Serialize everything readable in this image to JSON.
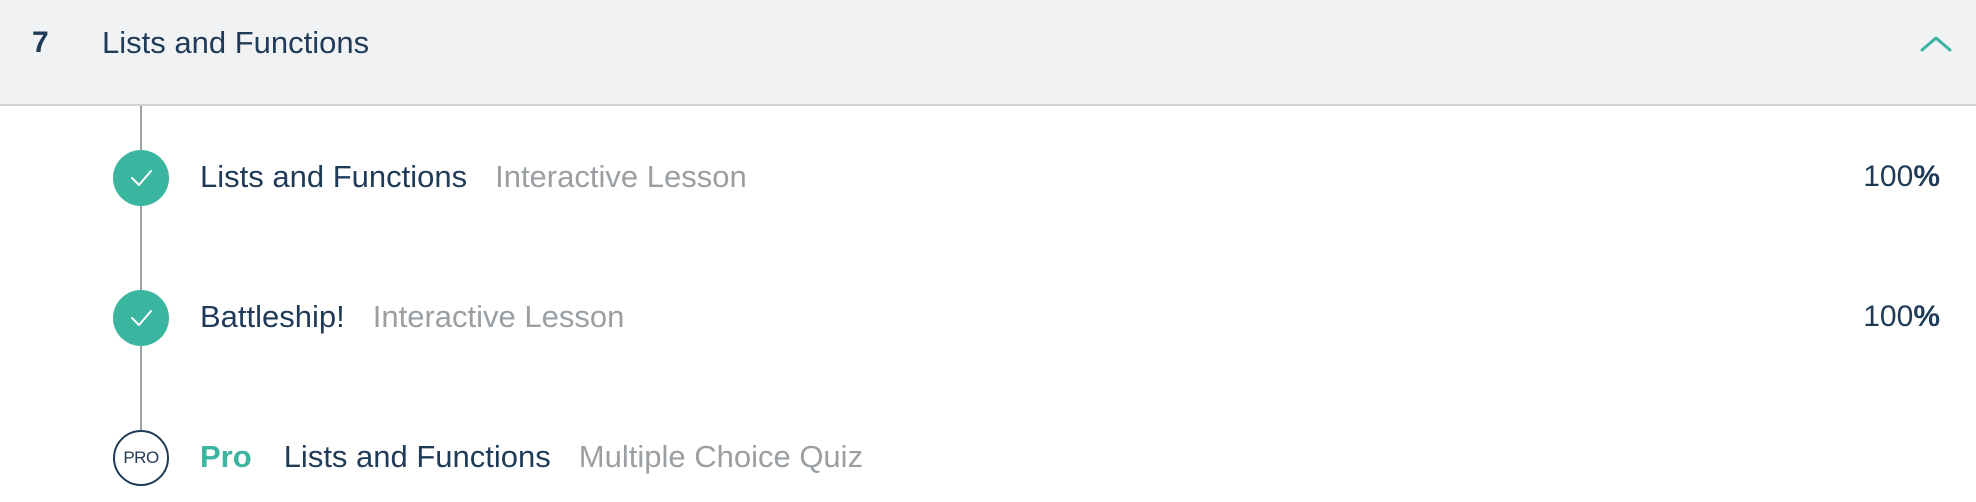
{
  "module": {
    "number": "7",
    "title": "Lists and Functions",
    "toggle_icon": "chevron-up-icon",
    "accent_color": "#3ab5a0"
  },
  "lessons": [
    {
      "title": "Lists and Functions",
      "type": "Interactive Lesson",
      "status": "complete",
      "status_icon": "check-icon",
      "progress_value": "100",
      "progress_unit": "%"
    },
    {
      "title": "Battleship!",
      "type": "Interactive Lesson",
      "status": "complete",
      "status_icon": "check-icon",
      "progress_value": "100",
      "progress_unit": "%"
    },
    {
      "badge": "PRO",
      "pro_label": "Pro",
      "title": "Lists and Functions",
      "type": "Multiple Choice Quiz",
      "status": "locked-pro"
    }
  ]
}
